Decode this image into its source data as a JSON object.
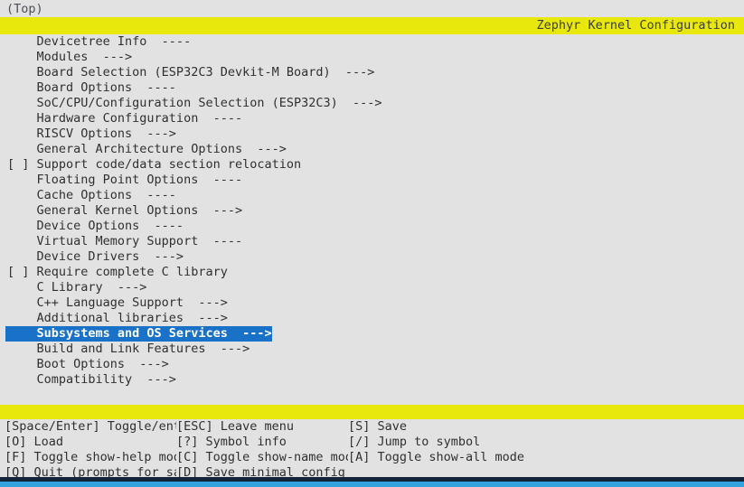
{
  "window": {
    "title": "Zephyr Kernel Configuration",
    "scroll_position": "(Top)",
    "colors": {
      "background": "#e2e2e2",
      "titlebar": "#e8e80d",
      "selection": "#1a72c8",
      "text": "#303030",
      "accent_bottom": "#35a3dd",
      "frame": "#262622"
    }
  },
  "menu": {
    "items": [
      {
        "prefix": "    ",
        "label": "Devicetree Info",
        "suffix": "  ----",
        "selected": false
      },
      {
        "prefix": "    ",
        "label": "Modules",
        "suffix": "  --->",
        "selected": false
      },
      {
        "prefix": "    ",
        "label": "Board Selection (ESP32C3 Devkit-M Board)",
        "suffix": "  --->",
        "selected": false
      },
      {
        "prefix": "    ",
        "label": "Board Options",
        "suffix": "  ----",
        "selected": false
      },
      {
        "prefix": "    ",
        "label": "SoC/CPU/Configuration Selection (ESP32C3)",
        "suffix": "  --->",
        "selected": false
      },
      {
        "prefix": "    ",
        "label": "Hardware Configuration",
        "suffix": "  ----",
        "selected": false
      },
      {
        "prefix": "    ",
        "label": "RISCV Options",
        "suffix": "  --->",
        "selected": false
      },
      {
        "prefix": "    ",
        "label": "General Architecture Options",
        "suffix": "  --->",
        "selected": false
      },
      {
        "prefix": "[ ] ",
        "label": "Support code/data section relocation",
        "suffix": "",
        "selected": false
      },
      {
        "prefix": "    ",
        "label": "Floating Point Options",
        "suffix": "  ----",
        "selected": false
      },
      {
        "prefix": "    ",
        "label": "Cache Options",
        "suffix": "  ----",
        "selected": false
      },
      {
        "prefix": "    ",
        "label": "General Kernel Options",
        "suffix": "  --->",
        "selected": false
      },
      {
        "prefix": "    ",
        "label": "Device Options",
        "suffix": "  ----",
        "selected": false
      },
      {
        "prefix": "    ",
        "label": "Virtual Memory Support",
        "suffix": "  ----",
        "selected": false
      },
      {
        "prefix": "    ",
        "label": "Device Drivers",
        "suffix": "  --->",
        "selected": false
      },
      {
        "prefix": "[ ] ",
        "label": "Require complete C library",
        "suffix": "",
        "selected": false
      },
      {
        "prefix": "    ",
        "label": "C Library",
        "suffix": "  --->",
        "selected": false
      },
      {
        "prefix": "    ",
        "label": "C++ Language Support",
        "suffix": "  --->",
        "selected": false
      },
      {
        "prefix": "    ",
        "label": "Additional libraries",
        "suffix": "  --->",
        "selected": false
      },
      {
        "prefix": "    ",
        "label": "Subsystems and OS Services",
        "suffix": "  --->",
        "selected": true
      },
      {
        "prefix": "    ",
        "label": "Build and Link Features",
        "suffix": "  --->",
        "selected": false
      },
      {
        "prefix": "    ",
        "label": "Boot Options",
        "suffix": "  --->",
        "selected": false
      },
      {
        "prefix": "    ",
        "label": "Compatibility",
        "suffix": "  --->",
        "selected": false
      }
    ]
  },
  "footer": {
    "rows": [
      [
        {
          "key": "[Space/Enter]",
          "action": "Toggle/enter"
        },
        {
          "key": "[ESC]",
          "action": "Leave menu"
        },
        {
          "key": "[S]",
          "action": "Save"
        }
      ],
      [
        {
          "key": "[O]",
          "action": "Load"
        },
        {
          "key": "[?]",
          "action": "Symbol info"
        },
        {
          "key": "[/]",
          "action": "Jump to symbol"
        }
      ],
      [
        {
          "key": "[F]",
          "action": "Toggle show-help mode"
        },
        {
          "key": "[C]",
          "action": "Toggle show-name mode"
        },
        {
          "key": "[A]",
          "action": "Toggle show-all mode"
        }
      ],
      [
        {
          "key": "[Q]",
          "action": "Quit (prompts for save)"
        },
        {
          "key": "[D]",
          "action": "Save minimal config (advanced)"
        },
        {
          "key": "",
          "action": ""
        }
      ]
    ]
  }
}
